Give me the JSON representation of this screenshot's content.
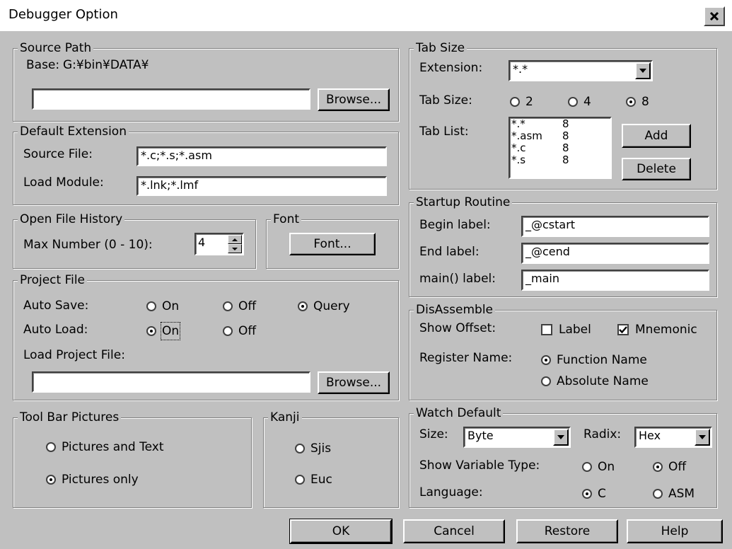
{
  "window": {
    "title": "Debugger Option"
  },
  "source_path": {
    "legend": "Source Path",
    "base_label": "Base:",
    "base_value": "G:¥bin¥DATA¥",
    "path_value": "",
    "browse_label": "Browse..."
  },
  "default_extension": {
    "legend": "Default Extension",
    "source_file_label": "Source File:",
    "source_file_value": "*.c;*.s;*.asm",
    "load_module_label": "Load Module:",
    "load_module_value": "*.lnk;*.lmf"
  },
  "open_file_history": {
    "legend": "Open File History",
    "max_label": "Max Number (0 - 10):",
    "max_value": "4"
  },
  "font": {
    "legend": "Font",
    "button_label": "Font..."
  },
  "project_file": {
    "legend": "Project File",
    "auto_save_label": "Auto Save:",
    "auto_save_options": [
      "On",
      "Off",
      "Query"
    ],
    "auto_save_selected": "Query",
    "auto_load_label": "Auto Load:",
    "auto_load_options": [
      "On",
      "Off"
    ],
    "auto_load_selected": "On",
    "load_project_label": "Load Project File:",
    "load_project_value": "",
    "browse_label": "Browse..."
  },
  "toolbar_pictures": {
    "legend": "Tool Bar Pictures",
    "options": [
      "Pictures and Text",
      "Pictures only"
    ],
    "selected": "Pictures only"
  },
  "kanji": {
    "legend": "Kanji",
    "options": [
      "Sjis",
      "Euc"
    ],
    "selected": ""
  },
  "tab_size": {
    "legend": "Tab Size",
    "extension_label": "Extension:",
    "extension_value": "*.*",
    "tab_size_label": "Tab Size:",
    "tab_size_options": [
      "2",
      "4",
      "8"
    ],
    "tab_size_selected": "8",
    "tab_list_label": "Tab List:",
    "tab_list": [
      {
        "ext": "*.*",
        "size": "8"
      },
      {
        "ext": "*.asm",
        "size": "8"
      },
      {
        "ext": "*.c",
        "size": "8"
      },
      {
        "ext": "*.s",
        "size": "8"
      }
    ],
    "add_label": "Add",
    "delete_label": "Delete"
  },
  "startup_routine": {
    "legend": "Startup Routine",
    "begin_label": "Begin label:",
    "begin_value": "_@cstart",
    "end_label": "End label:",
    "end_value": "_@cend",
    "main_label": "main() label:",
    "main_value": "_main"
  },
  "disassemble": {
    "legend": "DisAssemble",
    "show_offset_label": "Show Offset:",
    "offset_options": [
      {
        "label": "Label",
        "checked": false
      },
      {
        "label": "Mnemonic",
        "checked": true
      }
    ],
    "register_name_label": "Register Name:",
    "register_options": [
      "Function Name",
      "Absolute Name"
    ],
    "register_selected": "Function Name"
  },
  "watch_default": {
    "legend": "Watch Default",
    "size_label": "Size:",
    "size_value": "Byte",
    "radix_label": "Radix:",
    "radix_value": "Hex",
    "show_type_label": "Show Variable Type:",
    "show_type_options": [
      "On",
      "Off"
    ],
    "show_type_selected": "Off",
    "language_label": "Language:",
    "language_options": [
      "C",
      "ASM"
    ],
    "language_selected": "C"
  },
  "buttons": {
    "ok": "OK",
    "cancel": "Cancel",
    "restore": "Restore",
    "help": "Help"
  }
}
